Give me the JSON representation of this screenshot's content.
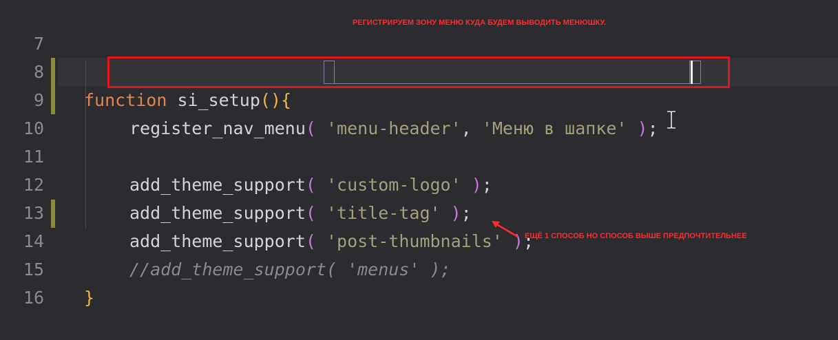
{
  "editor": {
    "lines": [
      {
        "num": "7"
      },
      {
        "num": "8"
      },
      {
        "num": "9"
      },
      {
        "num": "10"
      },
      {
        "num": "11"
      },
      {
        "num": "12"
      },
      {
        "num": "13"
      },
      {
        "num": "14"
      },
      {
        "num": "15"
      },
      {
        "num": "16"
      }
    ],
    "code": {
      "l8_kw": "function",
      "l8_name": " si_setup",
      "l8_parens": "()",
      "l8_brace": "{",
      "l9_fn": "register_nav_menu",
      "l9_open": "(",
      "l9_str1": " 'menu-header'",
      "l9_comma": ",",
      "l9_str2": " 'Меню в шапке' ",
      "l9_close": ")",
      "l9_semi": ";",
      "l11_fn": "add_theme_support",
      "l11_open": "(",
      "l11_str": " 'custom-logo' ",
      "l11_close": ")",
      "l11_semi": ";",
      "l12_fn": "add_theme_support",
      "l12_open": "(",
      "l12_str": " 'title-tag' ",
      "l12_close": ")",
      "l12_semi": ";",
      "l13_fn": "add_theme_support",
      "l13_open": "(",
      "l13_str": " 'post-thumbnails' ",
      "l13_close": ")",
      "l13_semi": ";",
      "l14_comment": "//add_theme_support( 'menus' );",
      "l15_brace": "}"
    }
  },
  "annotations": {
    "top_note": "РЕГИСТРИРУЕМ ЗОНУ МЕНЮ КУДА БУДЕМ ВЫВОДИТЬ МЕНЮШКУ.",
    "bottom_note": "ЕЩЁ 1 СПОСОБ НО СПОСОБ ВЫШЕ ПРЕДПОЧТИТЕЛЬНЕЕ"
  },
  "colors": {
    "background": "#2b2b30",
    "keyword": "#e5854e",
    "string": "#a3a07a",
    "paren": "#c678dd",
    "annotation": "#ff2a2a"
  }
}
